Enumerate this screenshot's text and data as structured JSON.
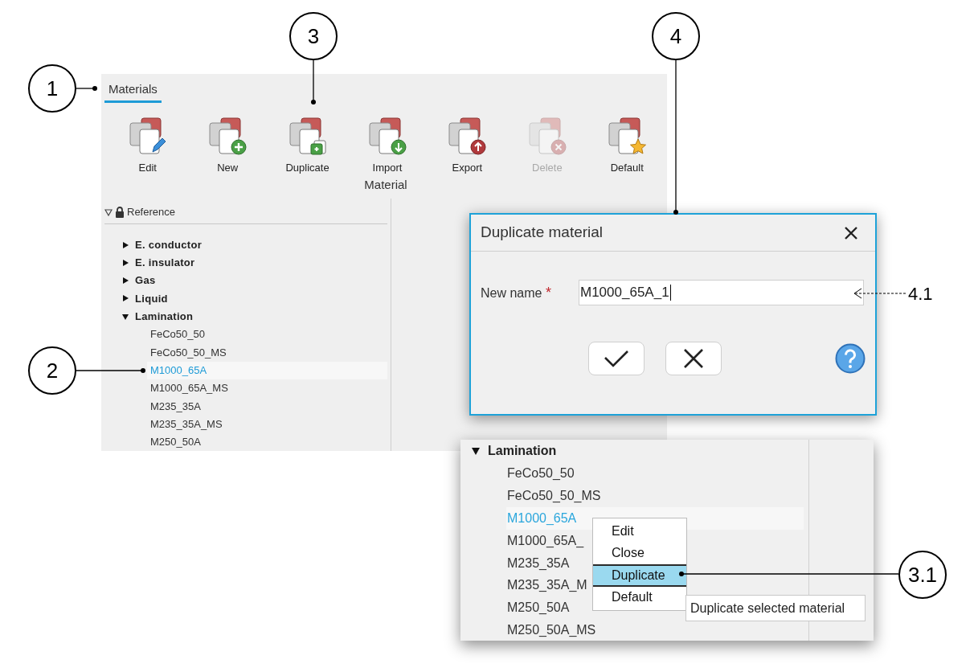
{
  "callouts": [
    {
      "label": "1"
    },
    {
      "label": "2"
    },
    {
      "label": "3"
    },
    {
      "label": "4"
    },
    {
      "label": "4.1"
    },
    {
      "label": "3.1"
    }
  ],
  "materials_panel": {
    "tab": {
      "label": "Materials",
      "selected": true
    },
    "toolbar": {
      "buttons": [
        {
          "label": "Edit",
          "disabled": false
        },
        {
          "label": "New",
          "disabled": false
        },
        {
          "label": "Duplicate",
          "disabled": false
        },
        {
          "label": "Import",
          "disabled": false
        },
        {
          "label": "Export",
          "disabled": false
        },
        {
          "label": "Delete",
          "disabled": true
        },
        {
          "label": "Default",
          "disabled": false
        }
      ],
      "group_label": "Material"
    },
    "tree": {
      "header": "Reference",
      "expanded": true,
      "items": [
        {
          "label": "E. conductor",
          "expanded": false
        },
        {
          "label": "E. insulator",
          "expanded": false
        },
        {
          "label": "Gas",
          "expanded": false
        },
        {
          "label": "Liquid",
          "expanded": false
        },
        {
          "label": "Lamination",
          "expanded": true,
          "children": [
            {
              "label": "FeCo50_50",
              "selected": false
            },
            {
              "label": "FeCo50_50_MS",
              "selected": false
            },
            {
              "label": "M1000_65A",
              "selected": true
            },
            {
              "label": "M1000_65A_MS",
              "selected": false
            },
            {
              "label": "M235_35A",
              "selected": false
            },
            {
              "label": "M235_35A_MS",
              "selected": false
            },
            {
              "label": "M250_50A",
              "selected": false
            }
          ]
        }
      ]
    }
  },
  "dialog": {
    "title": "Duplicate material",
    "field_label": "New name",
    "required_mark": "*",
    "value": "M1000_65A_1"
  },
  "zoom_panel": {
    "tree": {
      "items": [
        {
          "label": "Lamination",
          "expanded": true,
          "children": [
            {
              "label": "FeCo50_50",
              "selected": false
            },
            {
              "label": "FeCo50_50_MS",
              "selected": false
            },
            {
              "label": "M1000_65A",
              "selected": true
            },
            {
              "label": "M1000_65A_",
              "selected": false
            },
            {
              "label": "M235_35A",
              "selected": false
            },
            {
              "label": "M235_35A_M",
              "selected": false
            },
            {
              "label": "M250_50A",
              "selected": false
            },
            {
              "label": "M250_50A_MS",
              "selected": false
            }
          ]
        }
      ]
    },
    "context_menu": {
      "items": [
        {
          "label": "Edit",
          "selected": false
        },
        {
          "label": "Close",
          "selected": false
        },
        {
          "label": "Duplicate",
          "selected": true
        },
        {
          "label": "Default",
          "selected": false
        }
      ]
    },
    "tooltip": "Duplicate selected material"
  }
}
